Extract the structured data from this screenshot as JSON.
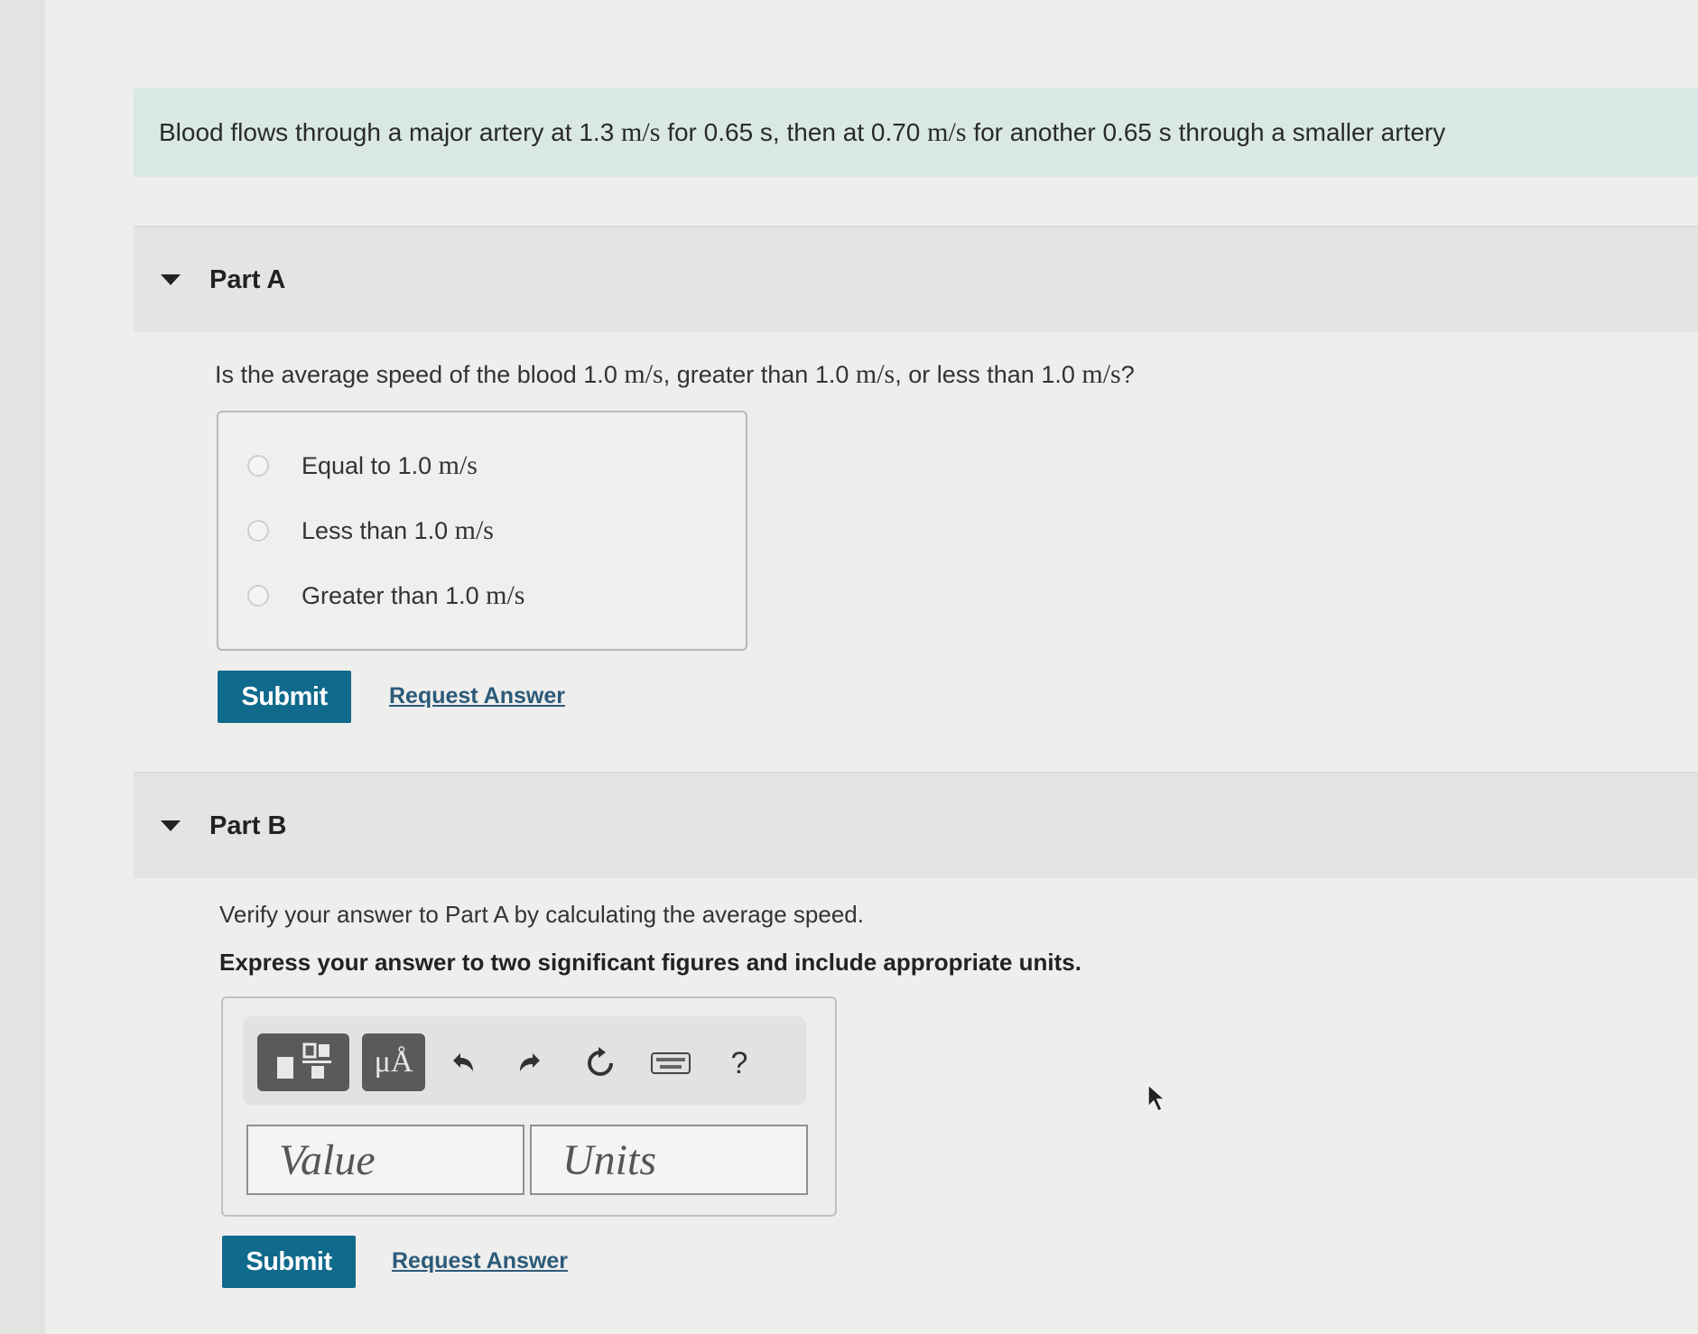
{
  "intro": {
    "text_1": "Blood flows through a major artery at 1.3",
    "unit_1": "m/s",
    "text_2": "for 0.65 s, then at 0.70",
    "unit_2": "m/s",
    "text_3": "for another 0.65 s through a smaller artery"
  },
  "part_a": {
    "title": "Part A",
    "question_1": "Is the average speed of the blood 1.0",
    "q_unit_1": "m/s",
    "question_2": ", greater than 1.0",
    "q_unit_2": "m/s",
    "question_3": ", or less than 1.0",
    "q_unit_3": "m/s",
    "question_4": "?",
    "options": [
      {
        "label": "Equal to 1.0",
        "unit": "m/s"
      },
      {
        "label": "Less than 1.0",
        "unit": "m/s"
      },
      {
        "label": "Greater than 1.0",
        "unit": "m/s"
      }
    ],
    "submit_label": "Submit",
    "request_label": "Request Answer"
  },
  "part_b": {
    "title": "Part B",
    "instruction": "Verify your answer to Part A by calculating the average speed.",
    "instruction_bold": "Express your answer to two significant figures and include appropriate units.",
    "toolbar": {
      "units_symbol": "μÅ",
      "help_symbol": "?"
    },
    "value_placeholder": "Value",
    "units_placeholder": "Units",
    "submit_label": "Submit",
    "request_label": "Request Answer"
  }
}
